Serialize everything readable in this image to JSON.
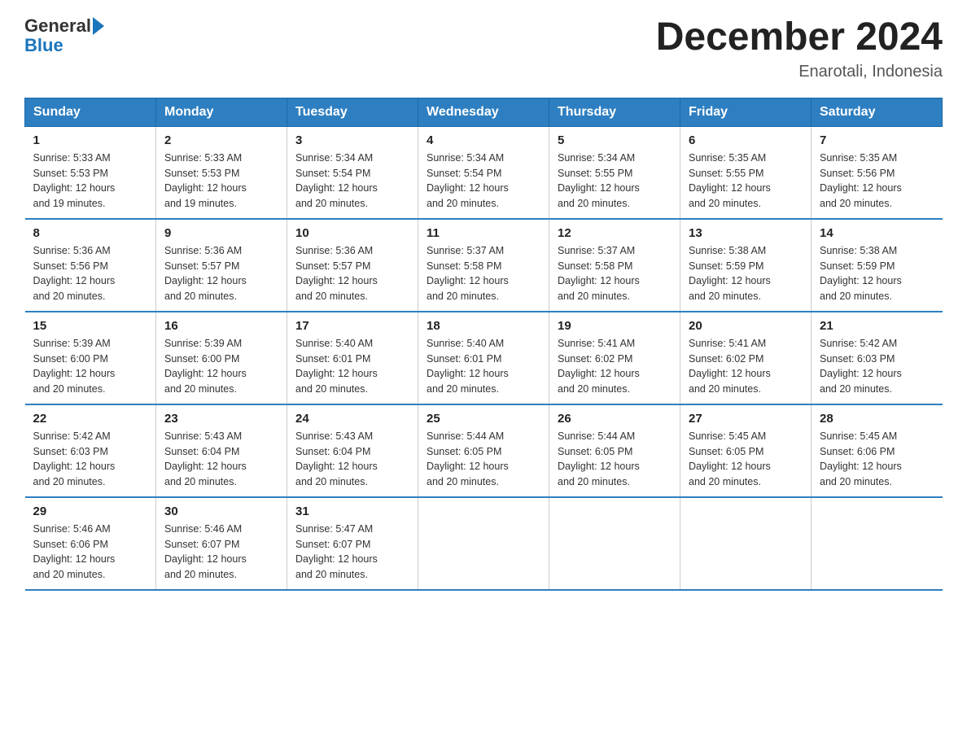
{
  "header": {
    "logo_general": "General",
    "logo_blue": "Blue",
    "title": "December 2024",
    "subtitle": "Enarotali, Indonesia"
  },
  "days_of_week": [
    "Sunday",
    "Monday",
    "Tuesday",
    "Wednesday",
    "Thursday",
    "Friday",
    "Saturday"
  ],
  "weeks": [
    [
      {
        "day": "1",
        "sunrise": "5:33 AM",
        "sunset": "5:53 PM",
        "daylight": "12 hours and 19 minutes."
      },
      {
        "day": "2",
        "sunrise": "5:33 AM",
        "sunset": "5:53 PM",
        "daylight": "12 hours and 19 minutes."
      },
      {
        "day": "3",
        "sunrise": "5:34 AM",
        "sunset": "5:54 PM",
        "daylight": "12 hours and 20 minutes."
      },
      {
        "day": "4",
        "sunrise": "5:34 AM",
        "sunset": "5:54 PM",
        "daylight": "12 hours and 20 minutes."
      },
      {
        "day": "5",
        "sunrise": "5:34 AM",
        "sunset": "5:55 PM",
        "daylight": "12 hours and 20 minutes."
      },
      {
        "day": "6",
        "sunrise": "5:35 AM",
        "sunset": "5:55 PM",
        "daylight": "12 hours and 20 minutes."
      },
      {
        "day": "7",
        "sunrise": "5:35 AM",
        "sunset": "5:56 PM",
        "daylight": "12 hours and 20 minutes."
      }
    ],
    [
      {
        "day": "8",
        "sunrise": "5:36 AM",
        "sunset": "5:56 PM",
        "daylight": "12 hours and 20 minutes."
      },
      {
        "day": "9",
        "sunrise": "5:36 AM",
        "sunset": "5:57 PM",
        "daylight": "12 hours and 20 minutes."
      },
      {
        "day": "10",
        "sunrise": "5:36 AM",
        "sunset": "5:57 PM",
        "daylight": "12 hours and 20 minutes."
      },
      {
        "day": "11",
        "sunrise": "5:37 AM",
        "sunset": "5:58 PM",
        "daylight": "12 hours and 20 minutes."
      },
      {
        "day": "12",
        "sunrise": "5:37 AM",
        "sunset": "5:58 PM",
        "daylight": "12 hours and 20 minutes."
      },
      {
        "day": "13",
        "sunrise": "5:38 AM",
        "sunset": "5:59 PM",
        "daylight": "12 hours and 20 minutes."
      },
      {
        "day": "14",
        "sunrise": "5:38 AM",
        "sunset": "5:59 PM",
        "daylight": "12 hours and 20 minutes."
      }
    ],
    [
      {
        "day": "15",
        "sunrise": "5:39 AM",
        "sunset": "6:00 PM",
        "daylight": "12 hours and 20 minutes."
      },
      {
        "day": "16",
        "sunrise": "5:39 AM",
        "sunset": "6:00 PM",
        "daylight": "12 hours and 20 minutes."
      },
      {
        "day": "17",
        "sunrise": "5:40 AM",
        "sunset": "6:01 PM",
        "daylight": "12 hours and 20 minutes."
      },
      {
        "day": "18",
        "sunrise": "5:40 AM",
        "sunset": "6:01 PM",
        "daylight": "12 hours and 20 minutes."
      },
      {
        "day": "19",
        "sunrise": "5:41 AM",
        "sunset": "6:02 PM",
        "daylight": "12 hours and 20 minutes."
      },
      {
        "day": "20",
        "sunrise": "5:41 AM",
        "sunset": "6:02 PM",
        "daylight": "12 hours and 20 minutes."
      },
      {
        "day": "21",
        "sunrise": "5:42 AM",
        "sunset": "6:03 PM",
        "daylight": "12 hours and 20 minutes."
      }
    ],
    [
      {
        "day": "22",
        "sunrise": "5:42 AM",
        "sunset": "6:03 PM",
        "daylight": "12 hours and 20 minutes."
      },
      {
        "day": "23",
        "sunrise": "5:43 AM",
        "sunset": "6:04 PM",
        "daylight": "12 hours and 20 minutes."
      },
      {
        "day": "24",
        "sunrise": "5:43 AM",
        "sunset": "6:04 PM",
        "daylight": "12 hours and 20 minutes."
      },
      {
        "day": "25",
        "sunrise": "5:44 AM",
        "sunset": "6:05 PM",
        "daylight": "12 hours and 20 minutes."
      },
      {
        "day": "26",
        "sunrise": "5:44 AM",
        "sunset": "6:05 PM",
        "daylight": "12 hours and 20 minutes."
      },
      {
        "day": "27",
        "sunrise": "5:45 AM",
        "sunset": "6:05 PM",
        "daylight": "12 hours and 20 minutes."
      },
      {
        "day": "28",
        "sunrise": "5:45 AM",
        "sunset": "6:06 PM",
        "daylight": "12 hours and 20 minutes."
      }
    ],
    [
      {
        "day": "29",
        "sunrise": "5:46 AM",
        "sunset": "6:06 PM",
        "daylight": "12 hours and 20 minutes."
      },
      {
        "day": "30",
        "sunrise": "5:46 AM",
        "sunset": "6:07 PM",
        "daylight": "12 hours and 20 minutes."
      },
      {
        "day": "31",
        "sunrise": "5:47 AM",
        "sunset": "6:07 PM",
        "daylight": "12 hours and 20 minutes."
      },
      null,
      null,
      null,
      null
    ]
  ],
  "labels": {
    "sunrise": "Sunrise:",
    "sunset": "Sunset:",
    "daylight": "Daylight:"
  }
}
